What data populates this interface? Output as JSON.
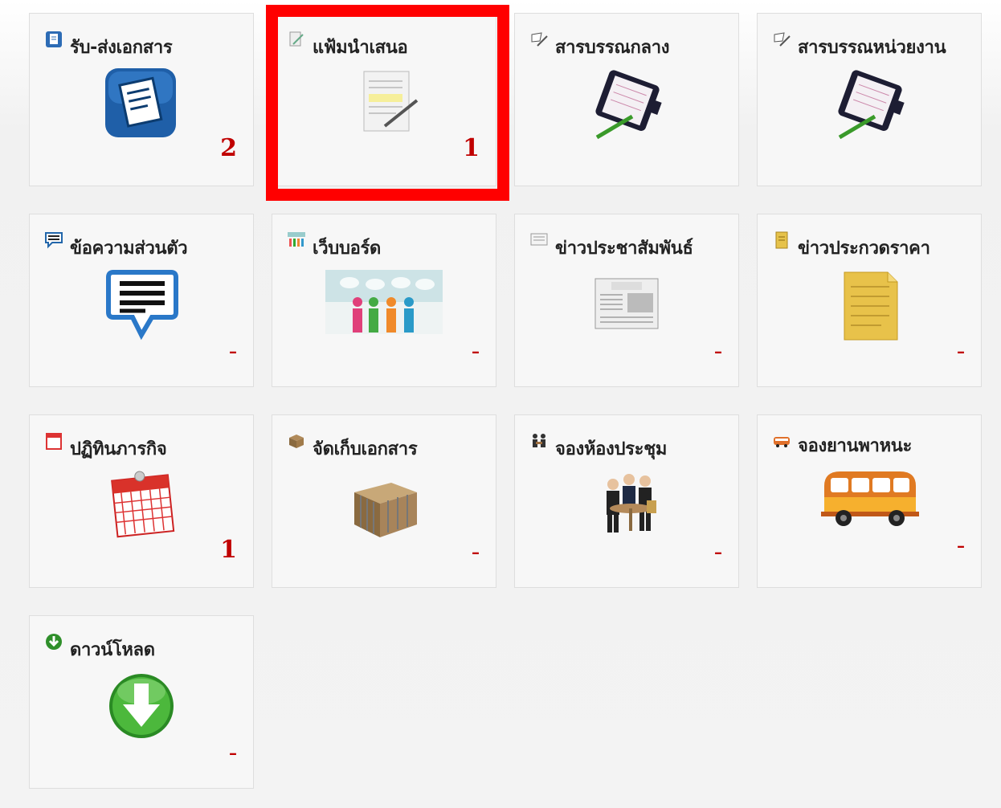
{
  "tiles": [
    {
      "title": "รับ-ส่งเอกสาร",
      "count": "2",
      "small_icon": "document-icon",
      "big_icon": "document-folder-icon"
    },
    {
      "title": "แฟ้มนำเสนอ",
      "count": "1",
      "small_icon": "pen-paper-icon",
      "big_icon": "signing-document-icon"
    },
    {
      "title": "สารบรรณกลาง",
      "count": "",
      "small_icon": "pen-icon",
      "big_icon": "notebook-pen-icon"
    },
    {
      "title": "สารบรรณหน่วยงาน",
      "count": "",
      "small_icon": "pen-icon",
      "big_icon": "notebook-pen-icon"
    },
    {
      "title": "ข้อความส่วนตัว",
      "count": "–",
      "small_icon": "chat-icon",
      "big_icon": "speech-bubble-icon"
    },
    {
      "title": "เว็บบอร์ด",
      "count": "–",
      "small_icon": "people-icon",
      "big_icon": "discussion-people-icon"
    },
    {
      "title": "ข่าวประชาสัมพันธ์",
      "count": "–",
      "small_icon": "news-icon",
      "big_icon": "newspaper-icon"
    },
    {
      "title": "ข่าวประกวดราคา",
      "count": "–",
      "small_icon": "note-icon",
      "big_icon": "notepad-icon"
    },
    {
      "title": "ปฏิทินภารกิจ",
      "count": "1",
      "small_icon": "calendar-small-icon",
      "big_icon": "calendar-icon"
    },
    {
      "title": "จัดเก็บเอกสาร",
      "count": "–",
      "small_icon": "box-small-icon",
      "big_icon": "archive-box-icon"
    },
    {
      "title": "จองห้องประชุม",
      "count": "–",
      "small_icon": "meeting-small-icon",
      "big_icon": "meeting-people-icon"
    },
    {
      "title": "จองยานพาหนะ",
      "count": "–",
      "small_icon": "bus-small-icon",
      "big_icon": "bus-icon"
    },
    {
      "title": "ดาวน์โหลด",
      "count": "–",
      "small_icon": "download-small-icon",
      "big_icon": "download-arrow-icon"
    }
  ],
  "colors": {
    "count": "#c00000",
    "highlight": "#ff0000",
    "tile_bg": "#f7f7f7"
  }
}
